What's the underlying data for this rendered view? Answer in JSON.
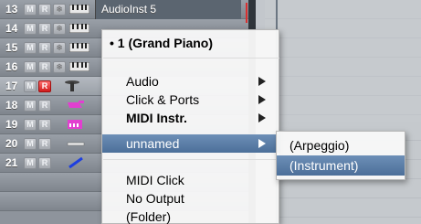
{
  "tracks": [
    {
      "num": "13",
      "m": "M",
      "r": "R",
      "freeze": "❄",
      "name": "AudioInst  5",
      "rec": false
    },
    {
      "num": "14",
      "m": "M",
      "r": "R",
      "freeze": "❄",
      "name": "",
      "rec": false
    },
    {
      "num": "15",
      "m": "M",
      "r": "R",
      "freeze": "❄",
      "name": "",
      "rec": false
    },
    {
      "num": "16",
      "m": "M",
      "r": "R",
      "freeze": "❄",
      "name": "",
      "rec": false
    },
    {
      "num": "17",
      "m": "M",
      "r": "R",
      "freeze": "",
      "name": "",
      "rec": true
    },
    {
      "num": "18",
      "m": "M",
      "r": "R",
      "freeze": "",
      "name": "",
      "rec": false
    },
    {
      "num": "19",
      "m": "M",
      "r": "R",
      "freeze": "",
      "name": "",
      "rec": false
    },
    {
      "num": "20",
      "m": "M",
      "r": "R",
      "freeze": "",
      "name": "",
      "rec": false
    },
    {
      "num": "21",
      "m": "M",
      "r": "R",
      "freeze": "",
      "name": "",
      "rec": false
    }
  ],
  "menu": {
    "checked_item": "• 1  (Grand Piano)",
    "items": {
      "audio": "Audio",
      "click_ports": "Click & Ports",
      "midi_instr": "MIDI Instr.",
      "unnamed": "unnamed",
      "midi_click": "MIDI Click",
      "no_output": "No Output",
      "folder": "(Folder)"
    }
  },
  "submenu": {
    "arpeggio": "(Arpeggio)",
    "instrument": "(Instrument)"
  },
  "colors": {
    "highlight": "#5a7ca6",
    "record_red": "#d11b1b",
    "track_bg": "#8e949c"
  }
}
